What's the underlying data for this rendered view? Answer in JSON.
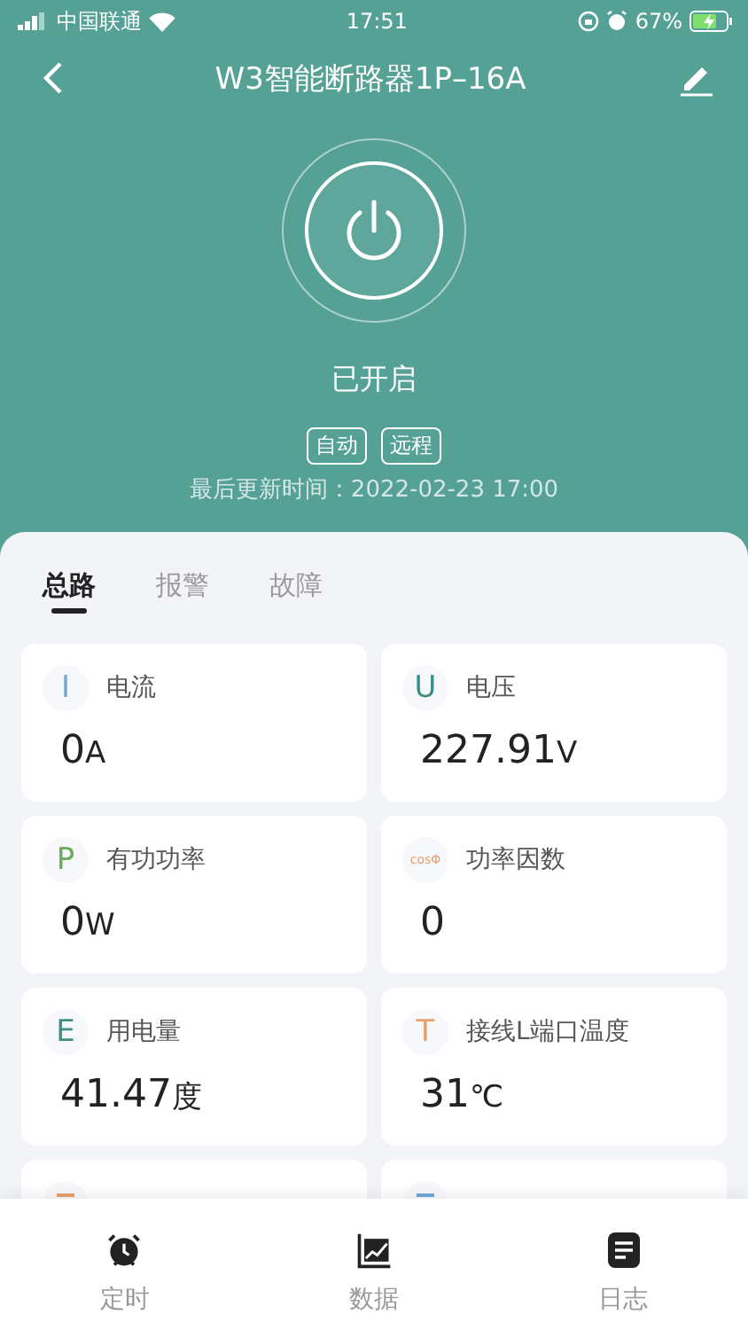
{
  "status_bar": {
    "carrier": "中国联通",
    "time": "17:51",
    "battery": "67%"
  },
  "header": {
    "title": "W3智能断路器1P–16A"
  },
  "device": {
    "on": true,
    "state": "已开启",
    "tags": [
      "自动",
      "远程"
    ],
    "updated": "最后更新时间：2022-02-23 17:00"
  },
  "tabs": [
    {
      "label": "总路",
      "selected": true
    },
    {
      "label": "报警",
      "selected": false
    },
    {
      "label": "故障",
      "selected": false
    }
  ],
  "metrics": [
    {
      "symbol": "I",
      "color": "#6fa8d6",
      "label": "电流",
      "value": "0",
      "unit": "A"
    },
    {
      "symbol": "U",
      "color": "#3d8f85",
      "label": "电压",
      "value": "227.91",
      "unit": "V"
    },
    {
      "symbol": "P",
      "color": "#6aaa5a",
      "label": "有功功率",
      "value": "0",
      "unit": "W"
    },
    {
      "symbol": "cosΦ",
      "color": "#e8a06a",
      "label": "功率因数",
      "value": "0"
    },
    {
      "symbol": "E",
      "color": "#3d8f85",
      "label": "用电量",
      "value": "41.47",
      "unit": "度"
    },
    {
      "symbol": "T",
      "color": "#e8a06a",
      "label": "接线L端口温度",
      "value": "31",
      "unit": "℃"
    },
    {
      "color": "#e8a06a"
    },
    {
      "color": "#6fa8d6"
    }
  ],
  "bottom_nav": [
    {
      "label": "定时",
      "kind": "alarm"
    },
    {
      "label": "数据",
      "kind": "chart"
    },
    {
      "label": "日志",
      "kind": "log"
    }
  ]
}
